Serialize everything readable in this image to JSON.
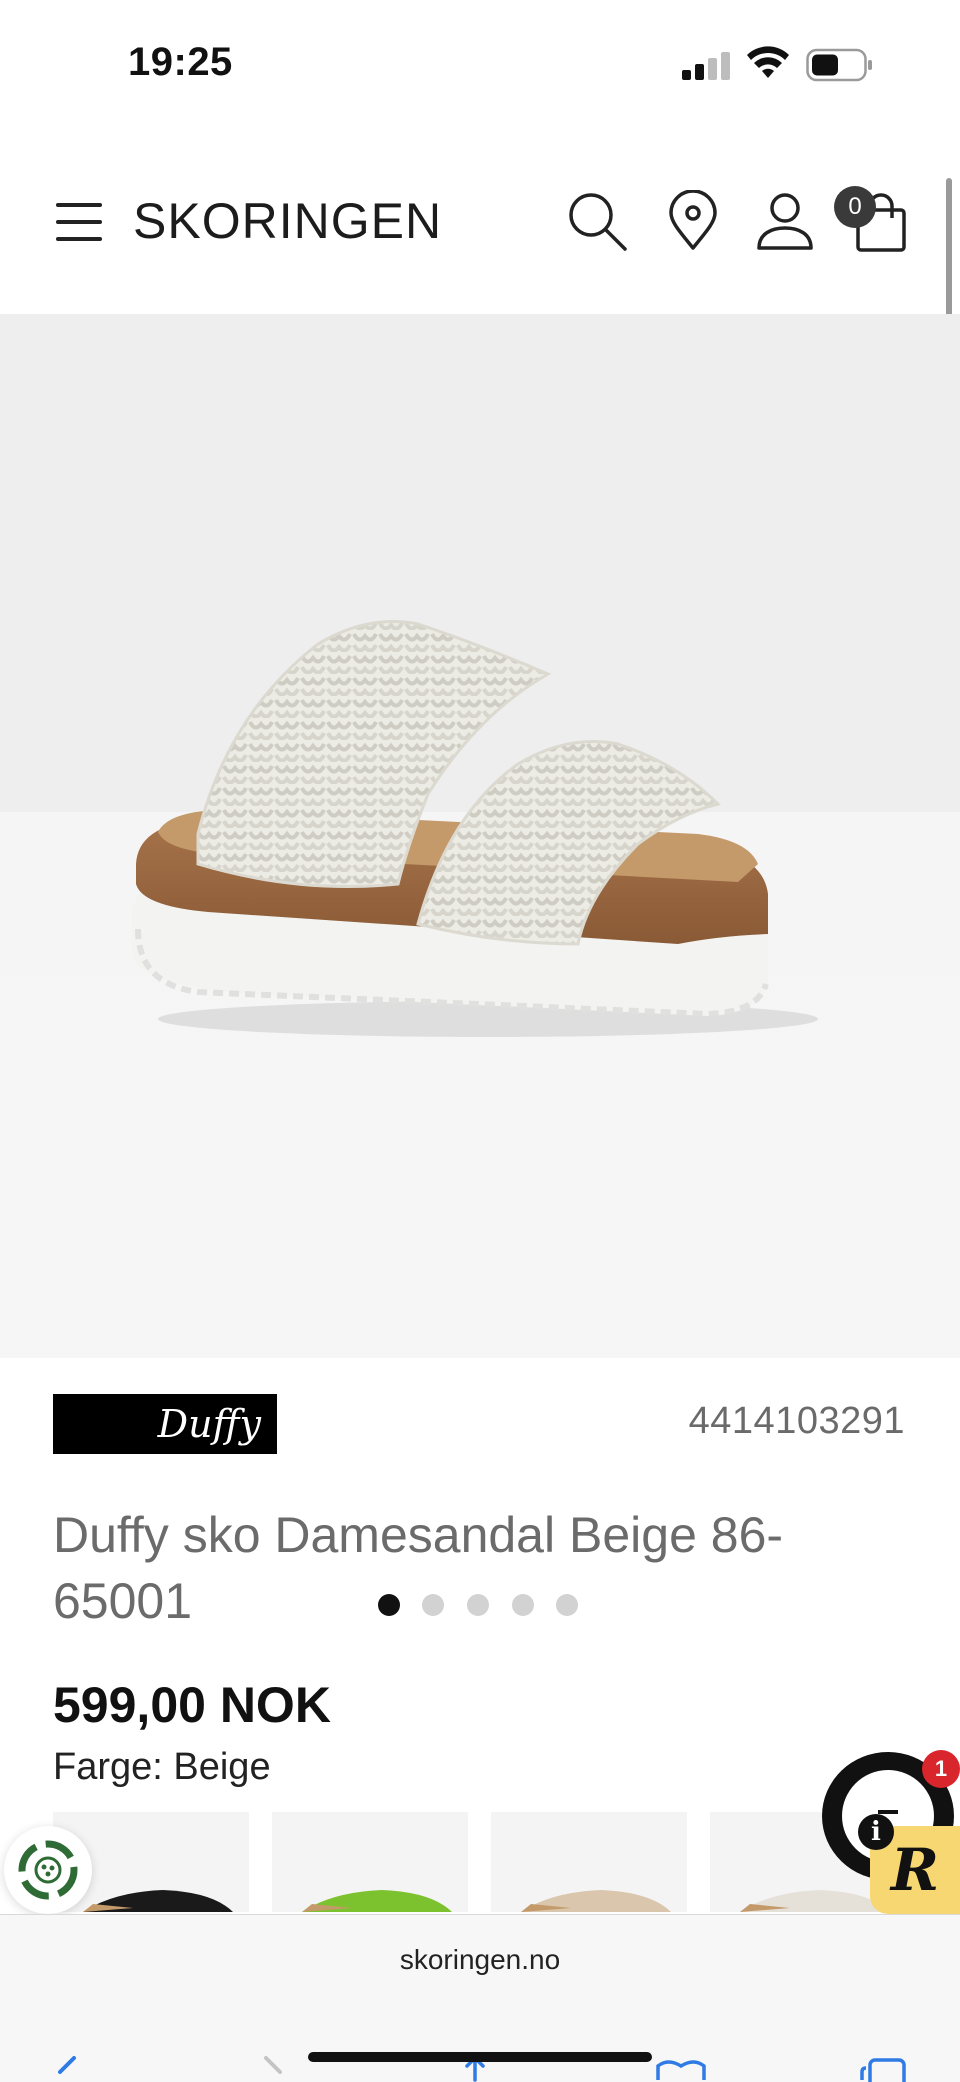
{
  "status_bar": {
    "time": "19:25"
  },
  "header": {
    "logo": "SKORINGEN",
    "cart_count": "0"
  },
  "gallery": {
    "image_count": 5,
    "active_index": 0
  },
  "product": {
    "brand": "Duffy",
    "sku": "4414103291",
    "title": "Duffy sko Damesandal Beige 86-65001",
    "price": "599,00 NOK",
    "color_label": "Farge: Beige",
    "swatches": [
      {
        "name": "black",
        "color": "#1a1a1a"
      },
      {
        "name": "green",
        "color": "#7cc22e"
      },
      {
        "name": "beige",
        "color": "#d9c6ad"
      },
      {
        "name": "white",
        "color": "#e6e1d8"
      }
    ]
  },
  "chat": {
    "notification_count": "1",
    "reviews_letter": "R",
    "info_letter": "i"
  },
  "browser": {
    "url": "skoringen.no"
  },
  "colors": {
    "brand_bg": "#000000",
    "badge_red": "#d8262c",
    "reviews_yellow": "#f7d772"
  }
}
